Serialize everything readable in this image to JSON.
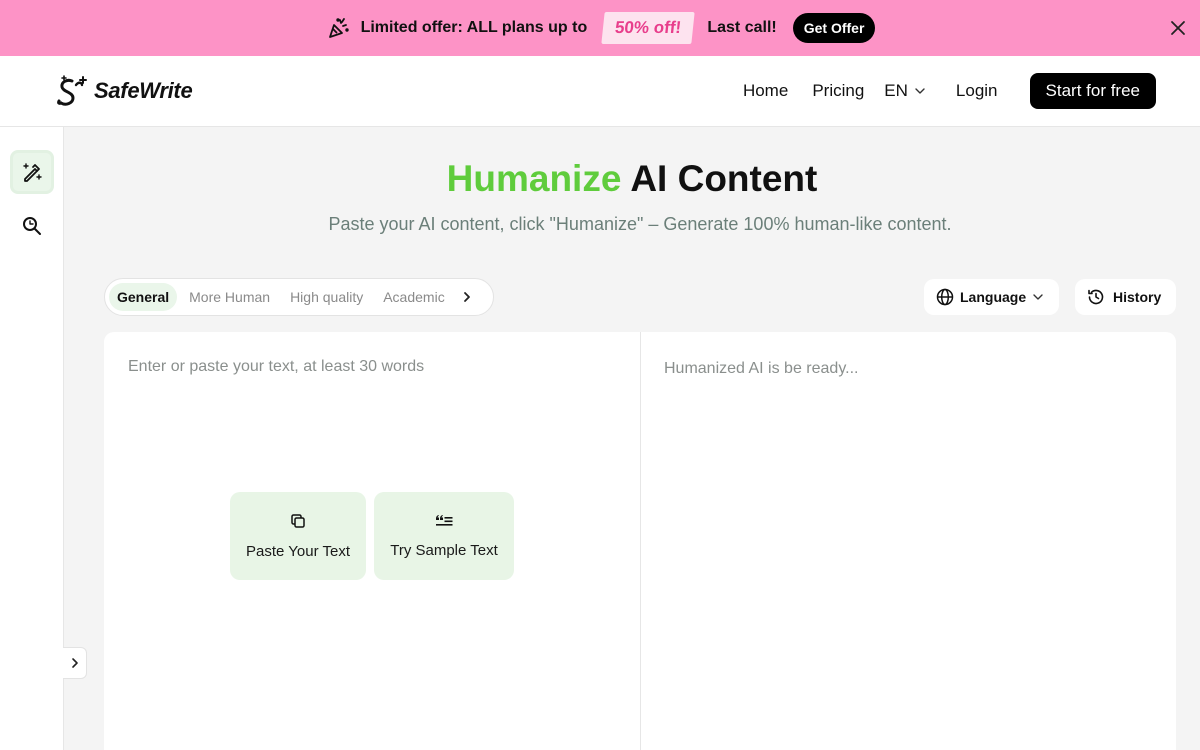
{
  "promo": {
    "text": "Limited offer: ALL plans up to",
    "discount": "50% off!",
    "last_call": "Last call!",
    "button": "Get Offer",
    "bg_color": "#fd93c6"
  },
  "header": {
    "logo_text": "SafeWrite",
    "nav": {
      "home": "Home",
      "pricing": "Pricing",
      "language": "EN",
      "login": "Login",
      "cta": "Start for free"
    }
  },
  "rail": {
    "items": [
      {
        "icon": "magic-pencil-icon",
        "active": true
      },
      {
        "icon": "search-icon",
        "active": false
      }
    ]
  },
  "hero": {
    "title_accent": "Humanize",
    "title_rest": " AI Content",
    "subtitle": "Paste your AI content, click \"Humanize\" – Generate 100% human-like content.",
    "accent_color": "#5fcc3c"
  },
  "modes": [
    "General",
    "More Human",
    "High quality",
    "Academic"
  ],
  "toolbar": {
    "language": "Language",
    "history": "History"
  },
  "editor": {
    "input_placeholder": "Enter or paste your text, at least 30 words",
    "output_placeholder": "Humanized AI is be ready...",
    "paste_label": "Paste Your Text",
    "sample_label": "Try Sample Text"
  }
}
